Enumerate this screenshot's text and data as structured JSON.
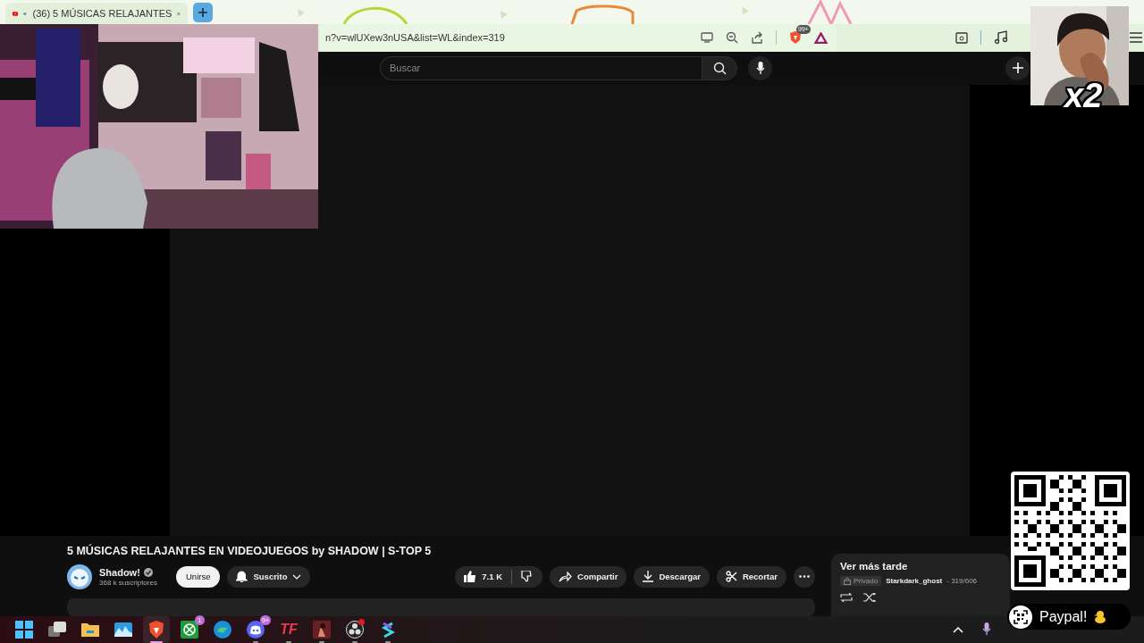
{
  "browser": {
    "tab": {
      "title": "(36) 5 MÚSICAS RELAJANTES",
      "audio_playing": true
    },
    "address": "n?v=wlUXew3nUSA&list=WL&index=319",
    "shields_badge": "99+"
  },
  "youtube": {
    "search": {
      "placeholder": "Buscar"
    },
    "video": {
      "title": "5 MÚSICAS RELAJANTES EN VIDEOJUEGOS by SHADOW | S-TOP 5",
      "channel": {
        "name": "Shadow!",
        "verified": true,
        "subscribers": "368 k suscriptores"
      },
      "join": "Unirse",
      "subscribe": "Suscrito",
      "likes": "7.1 K",
      "actions": [
        {
          "kind": "share",
          "label": "Compartir"
        },
        {
          "kind": "download",
          "label": "Descargar"
        },
        {
          "kind": "clip",
          "label": "Recortar"
        }
      ]
    },
    "playlist": {
      "title": "Ver más tarde",
      "privacy": "Privado",
      "owner": "Starkdark_ghost",
      "position": "- 319/606"
    }
  },
  "taskbar": {
    "apps": [
      {
        "kind": "start",
        "active": false,
        "running": false
      },
      {
        "kind": "task-view",
        "active": false,
        "running": false
      },
      {
        "kind": "folder",
        "active": false,
        "running": false
      },
      {
        "kind": "photos",
        "active": false,
        "running": false
      },
      {
        "kind": "lion",
        "active": true,
        "running": true
      },
      {
        "kind": "xbox",
        "active": false,
        "running": false,
        "badge": "1"
      },
      {
        "kind": "edge",
        "active": false,
        "running": false
      },
      {
        "kind": "discord",
        "active": false,
        "running": true,
        "badge": "9+"
      },
      {
        "kind": "tf",
        "active": false,
        "running": true,
        "label": "TF"
      },
      {
        "kind": "game",
        "active": false,
        "running": true
      },
      {
        "kind": "obs",
        "active": false,
        "running": true,
        "alert": true
      },
      {
        "kind": "app",
        "active": false,
        "running": true
      }
    ]
  },
  "overlays": {
    "facecam": {
      "kind": "picture",
      "label": "x2"
    },
    "donation": {
      "label": "Paypal!"
    }
  }
}
